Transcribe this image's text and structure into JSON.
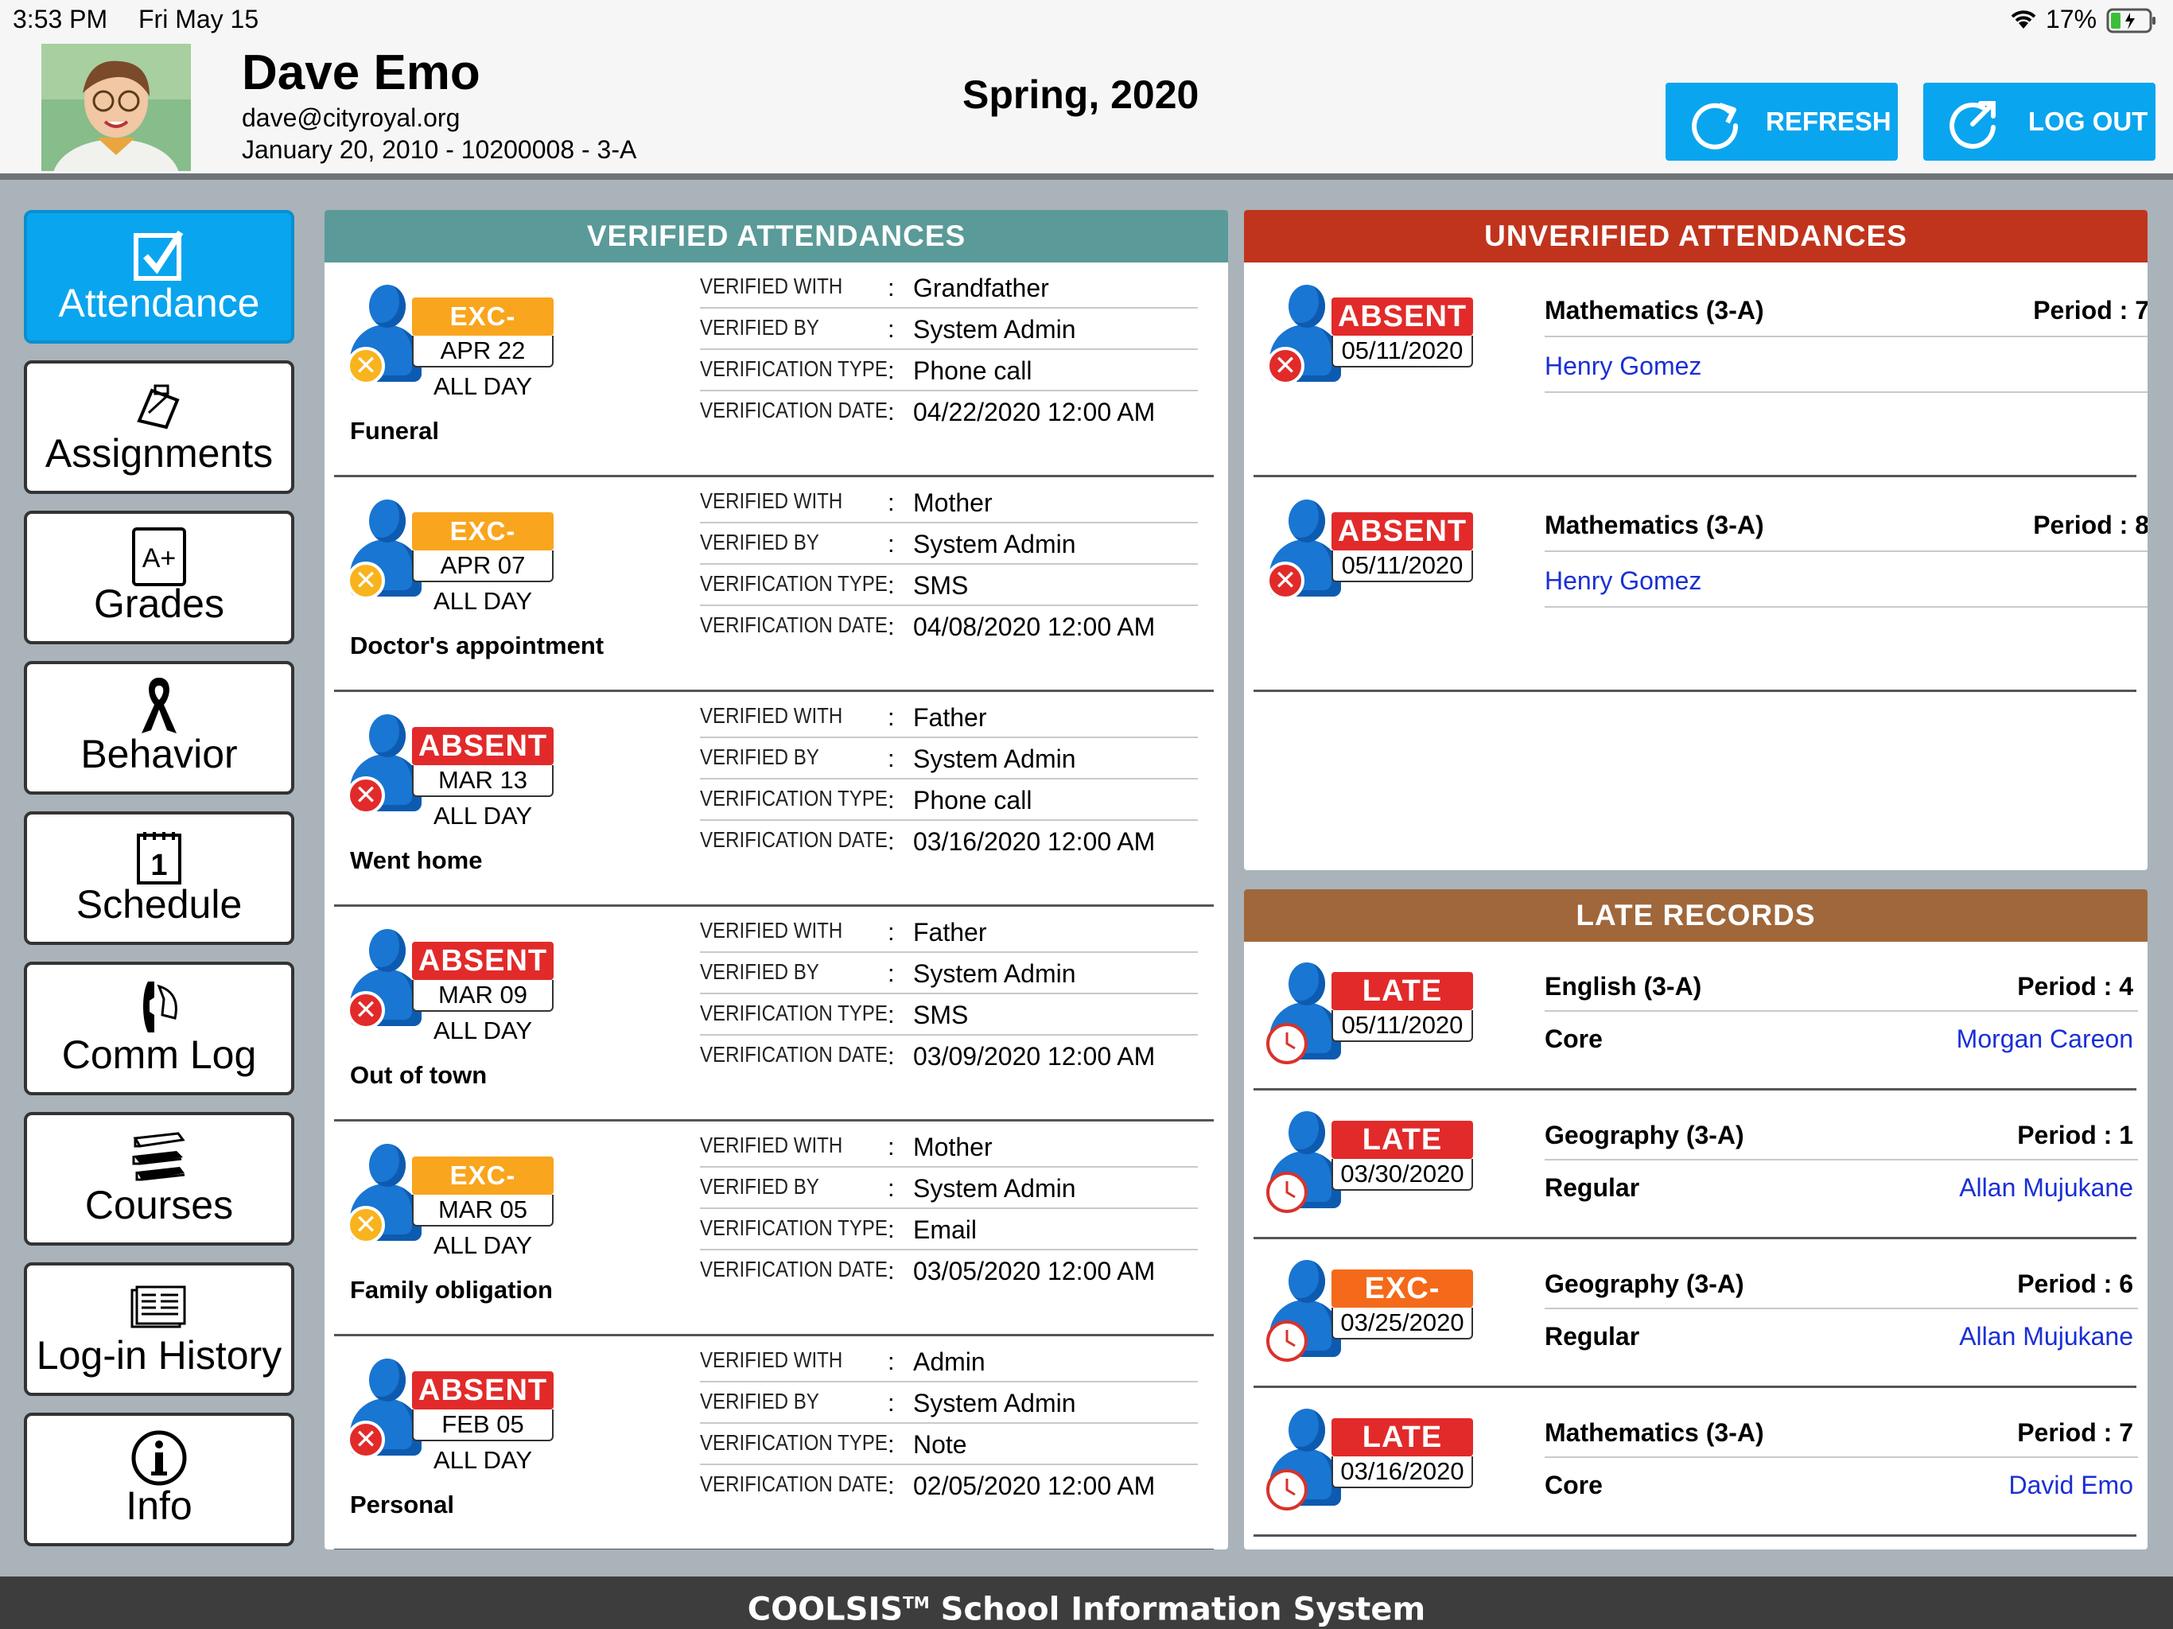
{
  "status_bar": {
    "time": "3:53 PM",
    "date": "Fri May 15",
    "battery": "17%"
  },
  "student": {
    "name": "Dave Emo",
    "email": "dave@cityroyal.org",
    "details": "January 20, 2010 - 10200008 - 3-A"
  },
  "term": "Spring, 2020",
  "header_buttons": {
    "refresh": "REFRESH",
    "logout": "LOG OUT"
  },
  "nav": [
    {
      "label": "Attendance",
      "icon": "checkbox-icon"
    },
    {
      "label": "Assignments",
      "icon": "clipboard-pencil-icon"
    },
    {
      "label": "Grades",
      "icon": "grade-a-plus-icon"
    },
    {
      "label": "Behavior",
      "icon": "ribbon-icon"
    },
    {
      "label": "Schedule",
      "icon": "calendar-icon"
    },
    {
      "label": "Comm Log",
      "icon": "phone-icon"
    },
    {
      "label": "Courses",
      "icon": "books-icon"
    },
    {
      "label": "Log-in History",
      "icon": "document-list-icon"
    },
    {
      "label": "Info",
      "icon": "info-icon"
    }
  ],
  "verified": {
    "title": "VERIFIED ATTENDANCES",
    "labels": {
      "with": "VERIFIED WITH",
      "by": "VERIFIED BY",
      "type": "VERIFICATION TYPE",
      "date": "VERIFICATION DATE",
      "colon": ":"
    },
    "rows": [
      {
        "status": "EXC-ABSENT",
        "date": "APR 22",
        "duration": "ALL DAY",
        "reason": "Funeral",
        "with": "Grandfather",
        "by": "System  Admin",
        "type": "Phone call",
        "vdate": "04/22/2020 12:00 AM"
      },
      {
        "status": "EXC-ABSENT",
        "date": "APR 07",
        "duration": "ALL DAY",
        "reason": "Doctor's appointment",
        "with": "Mother",
        "by": "System  Admin",
        "type": "SMS",
        "vdate": "04/08/2020 12:00 AM"
      },
      {
        "status": "ABSENT",
        "date": "MAR 13",
        "duration": "ALL DAY",
        "reason": "Went home",
        "with": "Father",
        "by": "System  Admin",
        "type": "Phone call",
        "vdate": "03/16/2020 12:00 AM"
      },
      {
        "status": "ABSENT",
        "date": "MAR 09",
        "duration": "ALL DAY",
        "reason": "Out of town",
        "with": "Father",
        "by": "System  Admin",
        "type": "SMS",
        "vdate": "03/09/2020 12:00 AM"
      },
      {
        "status": "EXC-ABSENT",
        "date": "MAR 05",
        "duration": "ALL DAY",
        "reason": "Family obligation",
        "with": "Mother",
        "by": "System  Admin",
        "type": "Email",
        "vdate": "03/05/2020 12:00 AM"
      },
      {
        "status": "ABSENT",
        "date": "FEB 05",
        "duration": "ALL DAY",
        "reason": "Personal",
        "with": "Admin",
        "by": "System  Admin",
        "type": "Note",
        "vdate": "02/05/2020 12:00 AM"
      }
    ]
  },
  "unverified": {
    "title": "UNVERIFIED ATTENDANCES",
    "rows": [
      {
        "status": "ABSENT",
        "date": "05/11/2020",
        "subject": "Mathematics  (3-A)",
        "period": "Period : 7",
        "teacher": "Henry Gomez"
      },
      {
        "status": "ABSENT",
        "date": "05/11/2020",
        "subject": "Mathematics  (3-A)",
        "period": "Period : 8",
        "teacher": "Henry Gomez"
      }
    ]
  },
  "late": {
    "title": "LATE RECORDS",
    "rows": [
      {
        "status": "LATE",
        "date": "05/11/2020",
        "subject": "English (3-A)",
        "period": "Period : 4",
        "category": "Core",
        "teacher": "Morgan Careon"
      },
      {
        "status": "LATE",
        "date": "03/30/2020",
        "subject": "Geography (3-A)",
        "period": "Period : 1",
        "category": "Regular",
        "teacher": "Allan Mujukane"
      },
      {
        "status": "EXC-LATE",
        "date": "03/25/2020",
        "subject": "Geography (3-A)",
        "period": "Period : 6",
        "category": "Regular",
        "teacher": "Allan Mujukane"
      },
      {
        "status": "LATE",
        "date": "03/16/2020",
        "subject": "Mathematics (3-A)",
        "period": "Period : 7",
        "category": "Core",
        "teacher": "David Emo"
      }
    ]
  },
  "footer": {
    "brand": "COOLSIS",
    "tm": "TM",
    "rest": " School Information System"
  },
  "colors": {
    "accent": "#0aa5ef",
    "verified_header": "#5a9a98",
    "unverified_header": "#c0341d",
    "late_header": "#a0673b",
    "absent": "#e22a2a",
    "excused": "#f9a51d",
    "teacher_link": "#1a2fd6"
  }
}
